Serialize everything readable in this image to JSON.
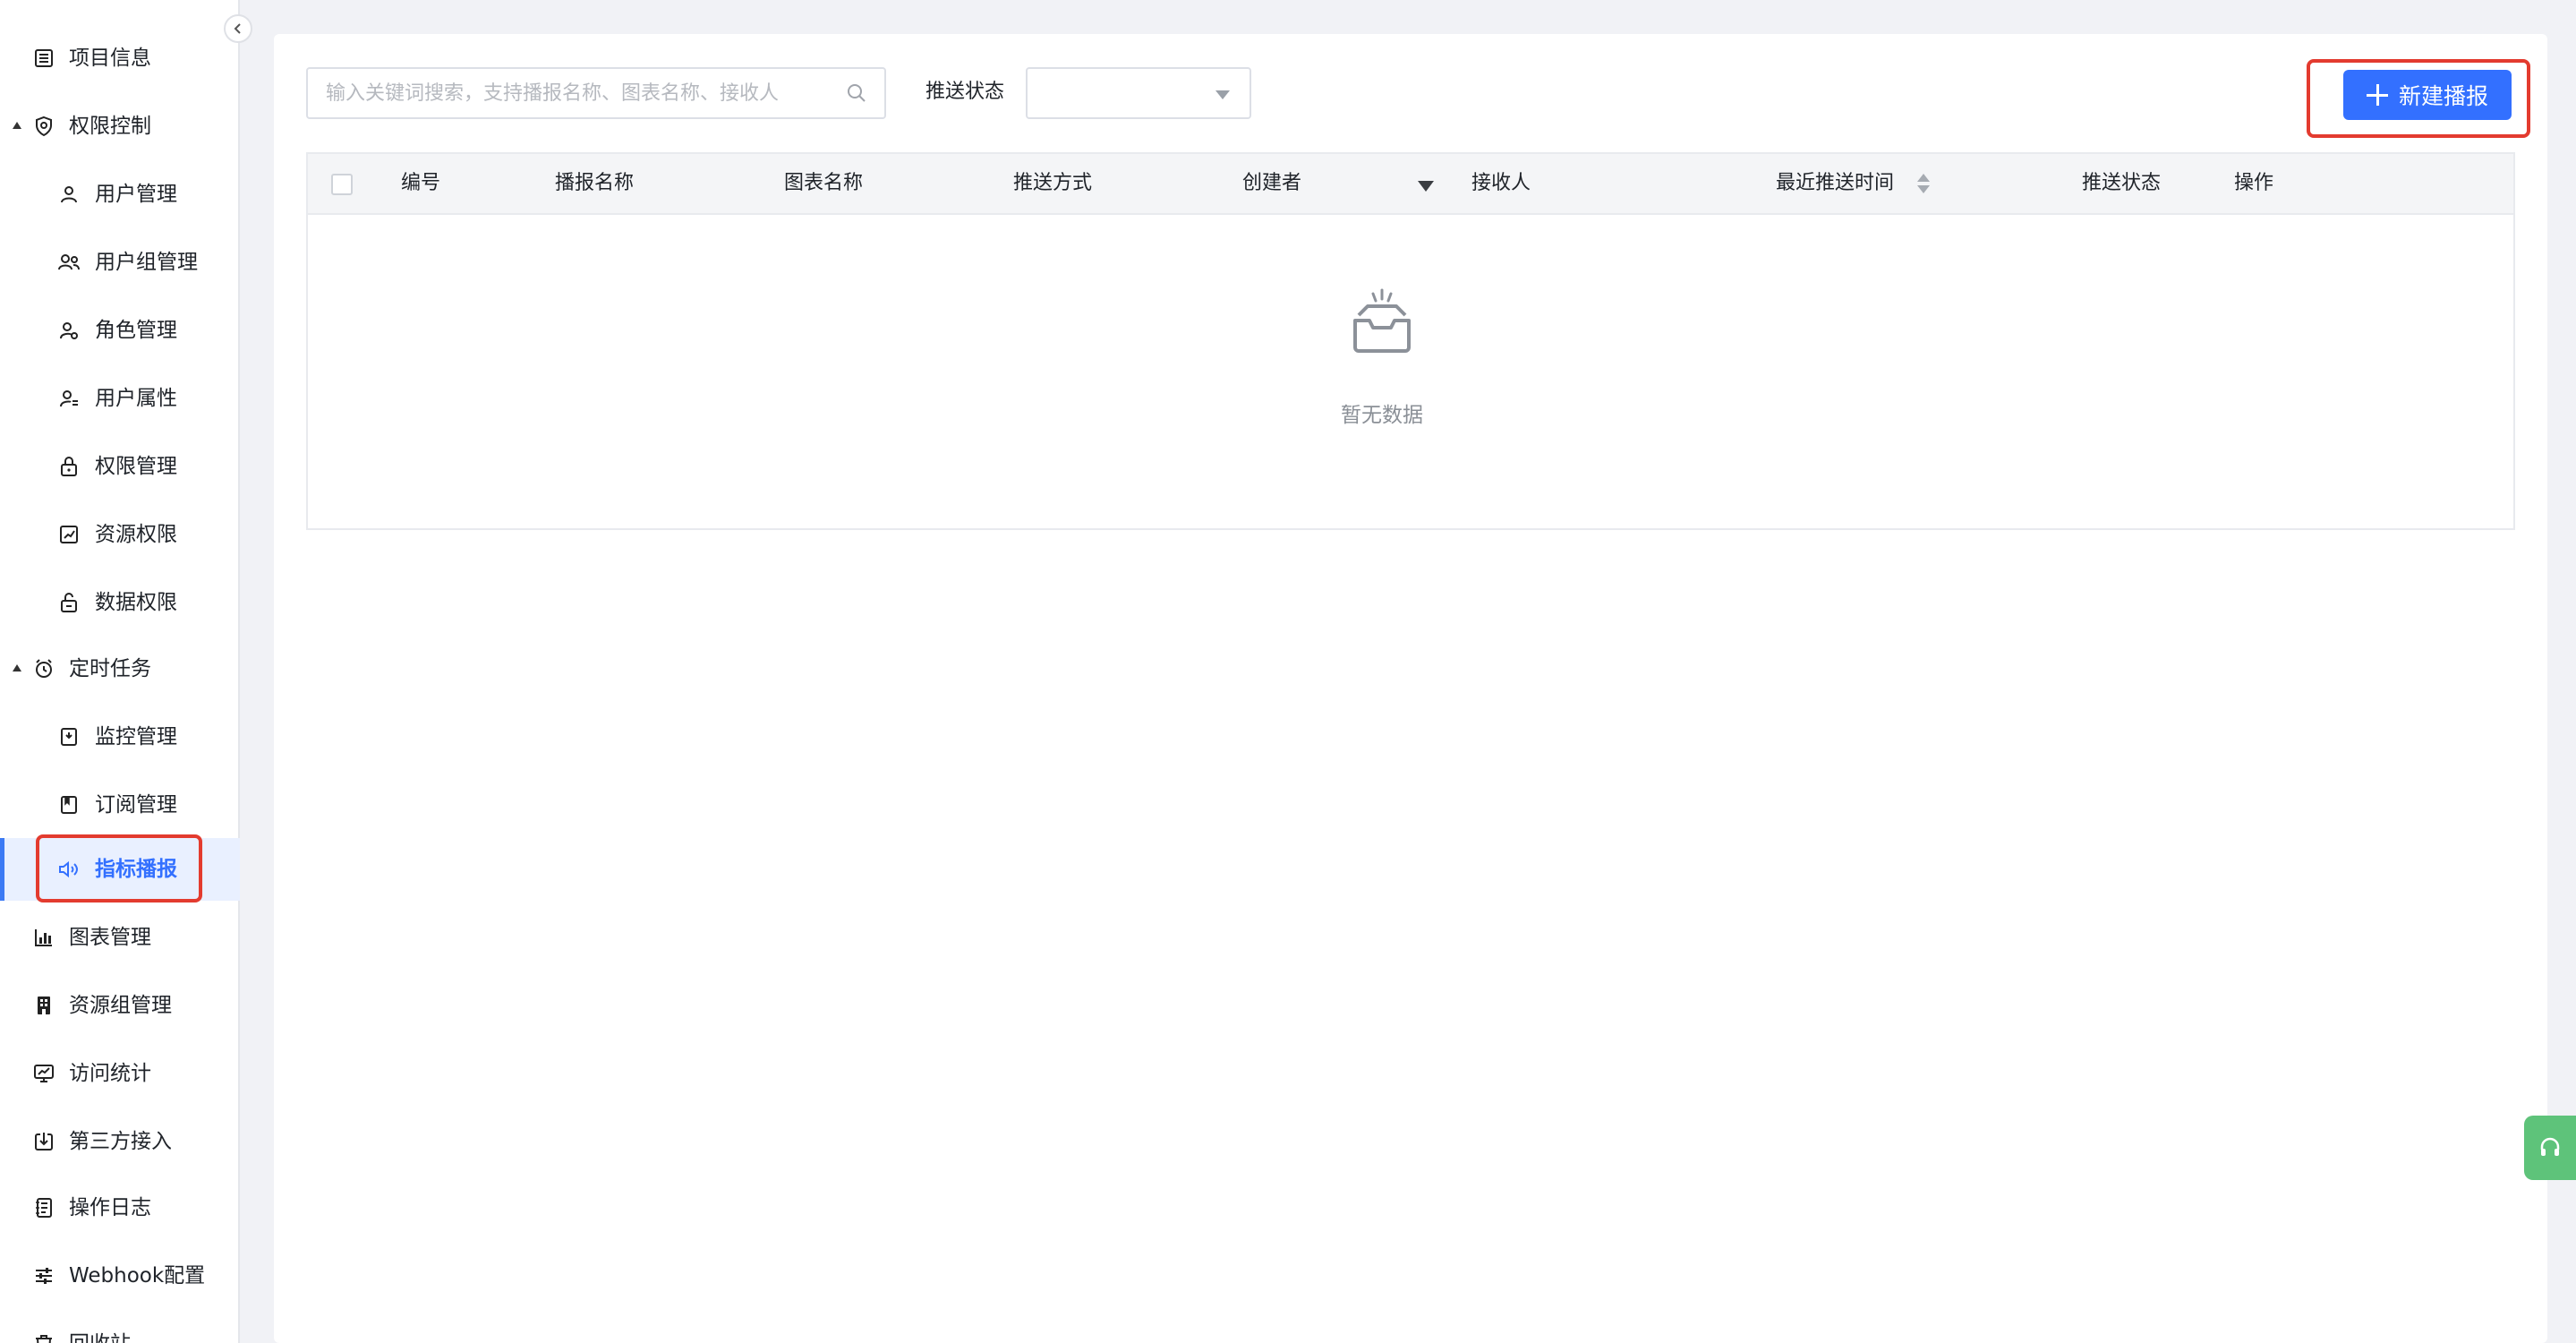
{
  "sidebar": {
    "items": [
      {
        "label": "项目信息",
        "icon": "list-icon"
      },
      {
        "label": "权限控制",
        "icon": "shield-icon"
      },
      {
        "label": "用户管理",
        "icon": "user-icon"
      },
      {
        "label": "用户组管理",
        "icon": "user-group-icon"
      },
      {
        "label": "角色管理",
        "icon": "role-icon"
      },
      {
        "label": "用户属性",
        "icon": "user-attribute-icon"
      },
      {
        "label": "权限管理",
        "icon": "lock-icon"
      },
      {
        "label": "资源权限",
        "icon": "resource-icon"
      },
      {
        "label": "数据权限",
        "icon": "data-lock-icon"
      },
      {
        "label": "定时任务",
        "icon": "alarm-clock-icon"
      },
      {
        "label": "监控管理",
        "icon": "monitor-icon"
      },
      {
        "label": "订阅管理",
        "icon": "bookmark-icon"
      },
      {
        "label": "指标播报",
        "icon": "speaker-icon"
      },
      {
        "label": "图表管理",
        "icon": "bar-chart-icon"
      },
      {
        "label": "资源组管理",
        "icon": "resource-group-icon"
      },
      {
        "label": "访问统计",
        "icon": "screen-chart-icon"
      },
      {
        "label": "第三方接入",
        "icon": "download-icon"
      },
      {
        "label": "操作日志",
        "icon": "log-icon"
      },
      {
        "label": "Webhook配置",
        "icon": "sliders-icon"
      },
      {
        "label": "回收站",
        "icon": "trash-icon"
      }
    ],
    "active": "指标播报"
  },
  "toolbar": {
    "search_placeholder": "输入关键词搜索，支持播报名称、图表名称、接收人",
    "status_label": "推送状态",
    "status_value": "",
    "new_button_label": "新建播报"
  },
  "table": {
    "columns": [
      "编号",
      "播报名称",
      "图表名称",
      "推送方式",
      "创建者",
      "接收人",
      "最近推送时间",
      "推送状态",
      "操作"
    ],
    "rows": [],
    "empty_text": "暂无数据"
  },
  "colors": {
    "primary": "#3370ff",
    "highlight": "#e33b2f",
    "help": "#5ec37a"
  }
}
